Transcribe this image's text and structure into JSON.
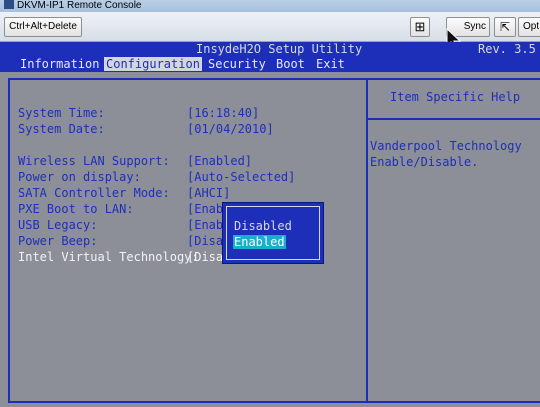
{
  "window": {
    "title": "DKVM-IP1 Remote Console"
  },
  "toolbar": {
    "cad_label": "Ctrl+Alt+Delete",
    "fit_icon": "fit-screen-icon",
    "sync_label": "Sync",
    "cursor_icon": "cursor-icon",
    "opt_label": "Opt"
  },
  "bios": {
    "utility_title": "InsydeH2O Setup Utility",
    "revision": "Rev. 3.5",
    "menu": [
      "Information",
      "Configuration",
      "Security",
      "Boot",
      "Exit"
    ],
    "active_menu": "Configuration",
    "settings": [
      {
        "label": "System Time:",
        "value": "[16:18:40]"
      },
      {
        "label": "System Date:",
        "value": "[01/04/2010]"
      },
      {
        "label": "Wireless LAN Support:",
        "value": "[Enabled]"
      },
      {
        "label": "Power on display:",
        "value": "[Auto-Selected]"
      },
      {
        "label": "SATA Controller Mode:",
        "value": "[AHCI]"
      },
      {
        "label": "PXE Boot to LAN:",
        "value": "[Enab"
      },
      {
        "label": "USB Legacy:",
        "value": "[Enab"
      },
      {
        "label": "Power Beep:",
        "value": "[Disa"
      },
      {
        "label": "Intel Virtual Technology:",
        "value": "[Disa"
      }
    ],
    "help_title": "Item Specific Help",
    "help_lines": [
      "Vanderpool Technology",
      "Enable/Disable."
    ],
    "popup": {
      "options": [
        "Disabled",
        "Enabled"
      ],
      "selected": "Enabled"
    },
    "colors": {
      "background": "#8d8f98",
      "text": "#1d2fb8",
      "highlight": "#18b0c8"
    }
  }
}
